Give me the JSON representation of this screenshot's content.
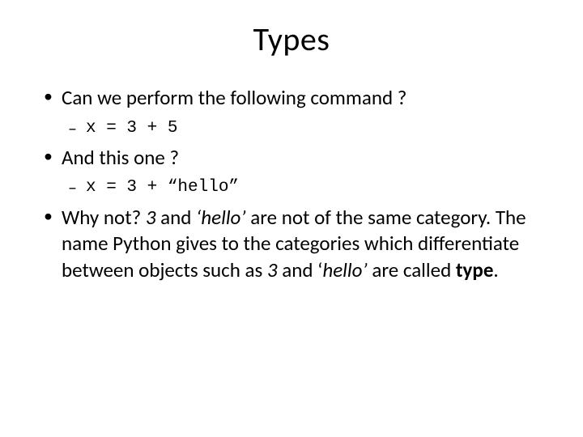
{
  "title": "Types",
  "bullets": {
    "b1": "Can we perform the following command ?",
    "b1_code": "x = 3 + 5",
    "b2": "And this one ?",
    "b2_code": "x = 3 + “hello”",
    "b3_part1": "Why not? ",
    "b3_i1": "3",
    "b3_part2": " and ",
    "b3_i2": "‘hello’",
    "b3_part3": " are not of the same category. The name Python gives to the categories which differentiate between objects such as ",
    "b3_i3": "3",
    "b3_part4": " and ‘",
    "b3_i4": "hello’",
    "b3_part5": "  are called ",
    "b3_bold": "type",
    "b3_part6": "."
  }
}
